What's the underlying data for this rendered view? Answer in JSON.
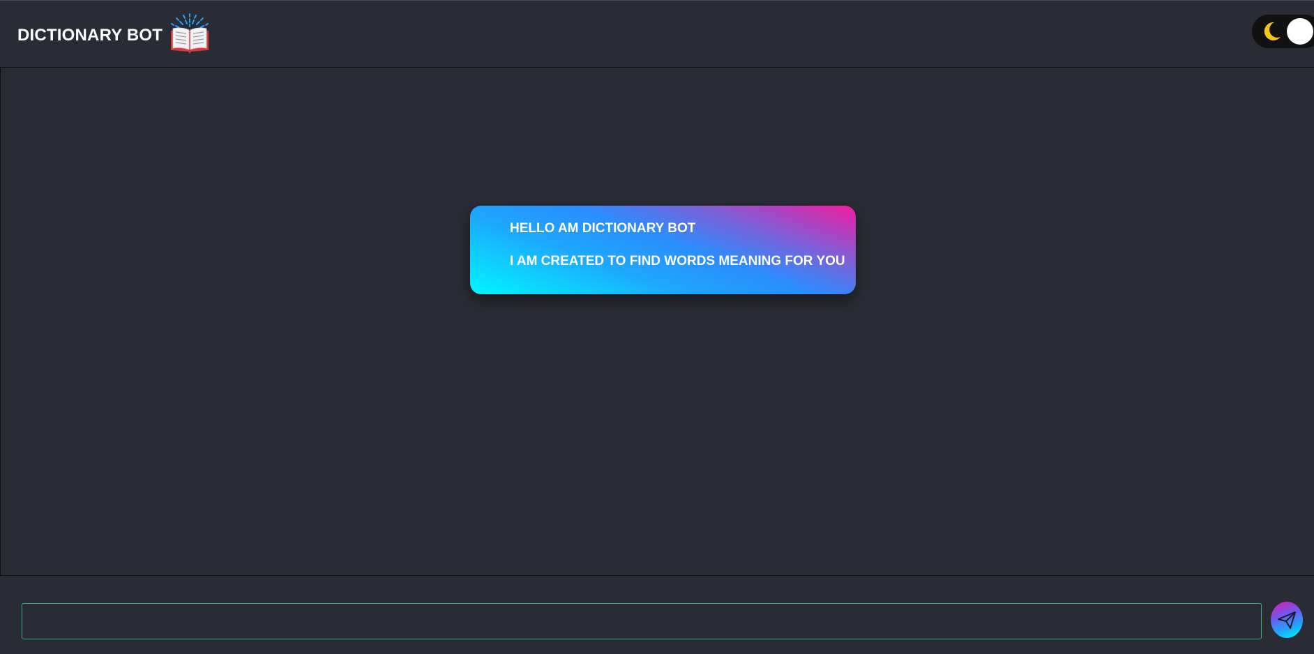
{
  "header": {
    "title": "DICTIONARY BOT",
    "logo_icon": "open-book-sparkles-icon"
  },
  "theme_toggle": {
    "icon": "moon-icon",
    "state": "dark"
  },
  "chat": {
    "messages": [
      {
        "sender": "bot",
        "lines": [
          "HELLO AM DICTIONARY BOT",
          "I AM CREATED TO FIND WORDS MEANING FOR YOU"
        ]
      }
    ]
  },
  "composer": {
    "value": "",
    "placeholder": "",
    "send_icon": "paper-plane-icon"
  },
  "colors": {
    "background": "#292c35",
    "input_border": "#3fae7b",
    "moon": "#f5c518",
    "gradient_cyan": "#00f7ff",
    "gradient_blue": "#1ea7fd",
    "gradient_pink": "#f31ca0"
  }
}
